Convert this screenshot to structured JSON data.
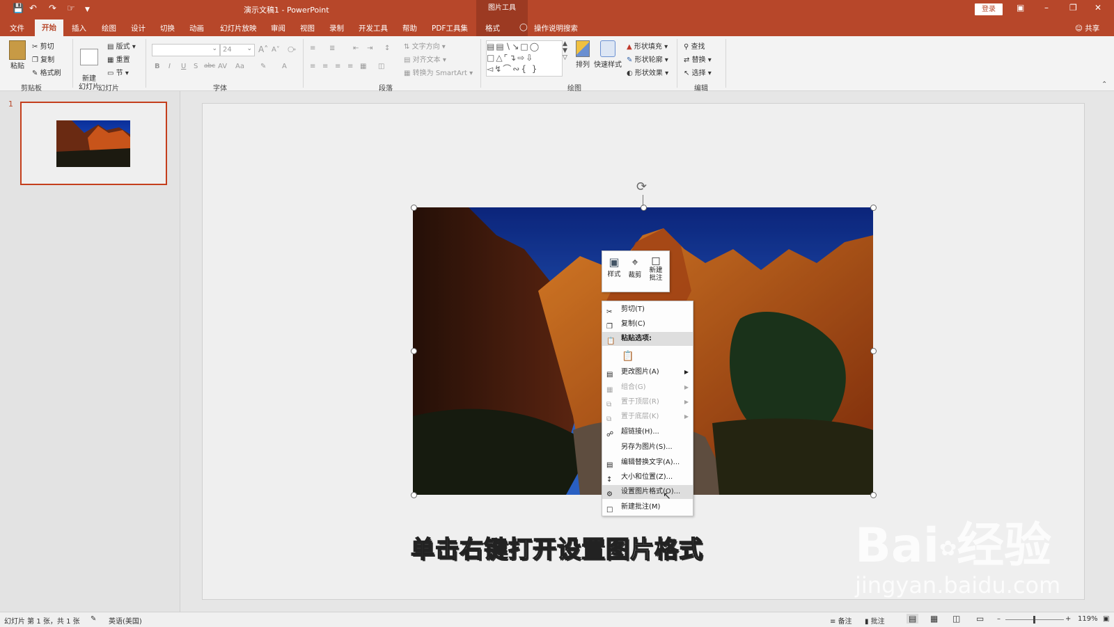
{
  "app": {
    "doc_title": "演示文稿1  -  PowerPoint",
    "context_tools": "图片工具",
    "login": "登录",
    "share": "共享",
    "search_hint": "操作说明搜索"
  },
  "tabs": [
    "文件",
    "开始",
    "插入",
    "绘图",
    "设计",
    "切换",
    "动画",
    "幻灯片放映",
    "审阅",
    "视图",
    "录制",
    "开发工具",
    "帮助",
    "PDF工具集",
    "格式"
  ],
  "ribbon": {
    "clipboard": {
      "label": "剪贴板",
      "paste": "粘贴",
      "cut": "剪切",
      "copy": "复制",
      "format_painter": "格式刷"
    },
    "slides": {
      "label": "幻灯片",
      "new_slide": "新建\n幻灯片",
      "layout": "版式",
      "reset": "重置",
      "section": "节"
    },
    "font": {
      "label": "字体",
      "font_size": "24"
    },
    "paragraph": {
      "label": "段落",
      "text_direction": "文字方向",
      "align_text": "对齐文本",
      "smartart": "转换为 SmartArt"
    },
    "drawing": {
      "label": "绘图",
      "arrange": "排列",
      "quick_styles": "快速样式",
      "shape_fill": "形状填充",
      "shape_outline": "形状轮廓",
      "shape_effects": "形状效果"
    },
    "editing": {
      "label": "编辑",
      "find": "查找",
      "replace": "替换",
      "select": "选择"
    }
  },
  "slide_pane": {
    "slide_number": "1"
  },
  "caption": "单击右键打开设置图片格式",
  "mini_toolbar": [
    {
      "label": "样式"
    },
    {
      "label": "裁剪"
    },
    {
      "label": "新建\n批注"
    }
  ],
  "context_menu": [
    {
      "label": "剪切(T)",
      "disabled": false,
      "submenu": false,
      "icon": "scissors-icon"
    },
    {
      "label": "复制(C)",
      "disabled": false,
      "submenu": false,
      "icon": "copy-icon"
    },
    {
      "label": "粘贴选项:",
      "disabled": false,
      "submenu": false,
      "icon": "paste-icon",
      "header": true
    },
    {
      "label": "",
      "disabled": false,
      "submenu": false,
      "icon": "paste-text-icon",
      "paste_option": true
    },
    {
      "label": "更改图片(A)",
      "disabled": false,
      "submenu": true,
      "icon": "change-picture-icon"
    },
    {
      "label": "组合(G)",
      "disabled": true,
      "submenu": true,
      "icon": "group-icon"
    },
    {
      "label": "置于顶层(R)",
      "disabled": true,
      "submenu": true,
      "icon": "bring-front-icon"
    },
    {
      "label": "置于底层(K)",
      "disabled": true,
      "submenu": true,
      "icon": "send-back-icon"
    },
    {
      "label": "超链接(H)...",
      "disabled": false,
      "submenu": false,
      "icon": "hyperlink-icon"
    },
    {
      "label": "另存为图片(S)...",
      "disabled": false,
      "submenu": false,
      "icon": ""
    },
    {
      "label": "编辑替换文字(A)...",
      "disabled": false,
      "submenu": false,
      "icon": "alt-text-icon"
    },
    {
      "label": "大小和位置(Z)...",
      "disabled": false,
      "submenu": false,
      "icon": "size-position-icon"
    },
    {
      "label": "设置图片格式(O)...",
      "disabled": false,
      "submenu": false,
      "icon": "format-picture-icon",
      "highlighted": true
    },
    {
      "label": "新建批注(M)",
      "disabled": false,
      "submenu": false,
      "icon": "comment-icon"
    }
  ],
  "status": {
    "slide_info": "幻灯片 第 1 张，共 1 张",
    "language": "英语(美国)",
    "notes": "备注",
    "comments": "批注",
    "zoom": "119%"
  },
  "watermark": {
    "brand": "Bai",
    "suffix": "经验",
    "url": "jingyan.baidu.com"
  },
  "colors": {
    "accent": "#b7472a",
    "highlight": "#dedede"
  }
}
